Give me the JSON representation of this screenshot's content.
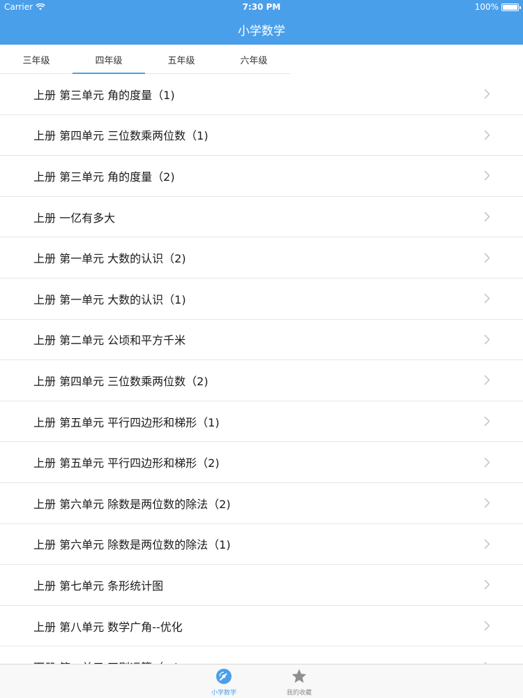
{
  "status_bar": {
    "carrier": "Carrier",
    "time": "7:30 PM",
    "battery": "100%"
  },
  "nav": {
    "title": "小学数学"
  },
  "grade_tabs": [
    {
      "label": "三年级",
      "active": false
    },
    {
      "label": "四年级",
      "active": true
    },
    {
      "label": "五年级",
      "active": false
    },
    {
      "label": "六年级",
      "active": false
    }
  ],
  "lessons": [
    "上册 第三单元 角的度量（1)",
    "上册 第四单元 三位数乘两位数（1)",
    "上册 第三单元 角的度量（2)",
    "上册 一亿有多大",
    "上册 第一单元 大数的认识（2)",
    "上册 第一单元 大数的认识（1)",
    "上册 第二单元 公顷和平方千米",
    "上册 第四单元 三位数乘两位数（2)",
    "上册 第五单元 平行四边形和梯形（1)",
    "上册 第五单元 平行四边形和梯形（2)",
    "上册 第六单元 除数是两位数的除法（2)",
    "上册 第六单元 除数是两位数的除法（1)",
    "上册 第七单元 条形统计图",
    "上册 第八单元 数学广角--优化",
    "下册 第一单元 四则运算（一)"
  ],
  "tab_bar": [
    {
      "label": "小学数学",
      "icon": "disc-icon",
      "active": true
    },
    {
      "label": "我的收藏",
      "icon": "star-icon",
      "active": false
    }
  ],
  "colors": {
    "accent": "#4a9fea",
    "divider": "#e5e5e5",
    "chevron": "#c7c7cc",
    "tabbar_inactive": "#8e8e8e"
  }
}
